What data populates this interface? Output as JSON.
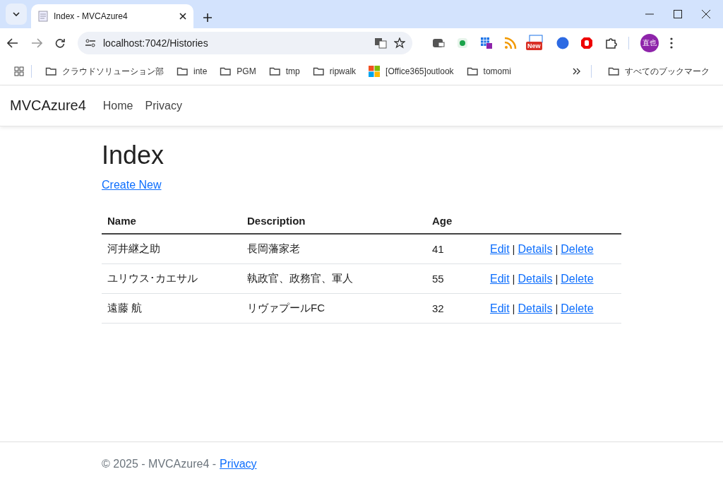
{
  "browser": {
    "tab_title": "Index - MVCAzure4",
    "address": "localhost:7042/Histories",
    "extension_badge": "New",
    "profile": "直也",
    "bookmarks": [
      {
        "kind": "folder",
        "label": "クラウドソリューション部"
      },
      {
        "kind": "folder",
        "label": "inte"
      },
      {
        "kind": "folder",
        "label": "PGM"
      },
      {
        "kind": "folder",
        "label": "tmp"
      },
      {
        "kind": "folder",
        "label": "ripwalk"
      },
      {
        "kind": "office",
        "label": "[Office365]outlook"
      },
      {
        "kind": "folder",
        "label": "tomomi"
      }
    ],
    "all_bookmarks": "すべてのブックマーク"
  },
  "navbar": {
    "brand": "MVCAzure4",
    "links": [
      "Home",
      "Privacy"
    ]
  },
  "page": {
    "heading": "Index",
    "create_link": "Create New"
  },
  "table": {
    "columns": [
      "Name",
      "Description",
      "Age"
    ],
    "rows": [
      {
        "name": "河井継之助",
        "description": "長岡藩家老",
        "age": "41",
        "actions": [
          {
            "kind": "link",
            "text": "Edit"
          },
          {
            "kind": "separator",
            "text": "|"
          },
          {
            "kind": "link",
            "text": "Details"
          },
          {
            "kind": "separator",
            "text": "|"
          },
          {
            "kind": "link",
            "text": "Delete"
          }
        ]
      },
      {
        "name": "ユリウス･カエサル",
        "description": "執政官、政務官、軍人",
        "age": "55",
        "actions": [
          {
            "kind": "link",
            "text": "Edit"
          },
          {
            "kind": "separator",
            "text": "|"
          },
          {
            "kind": "link",
            "text": "Details"
          },
          {
            "kind": "separator",
            "text": "|"
          },
          {
            "kind": "link",
            "text": "Delete"
          }
        ]
      },
      {
        "name": "遠藤 航",
        "description": "リヴァプールFC",
        "age": "32",
        "actions": [
          {
            "kind": "link",
            "text": "Edit"
          },
          {
            "kind": "separator",
            "text": "|"
          },
          {
            "kind": "link",
            "text": "Details"
          },
          {
            "kind": "separator",
            "text": "|"
          },
          {
            "kind": "link",
            "text": "Delete"
          }
        ]
      }
    ]
  },
  "footer": {
    "text": "© 2025 - MVCAzure4 -",
    "link": "Privacy"
  }
}
